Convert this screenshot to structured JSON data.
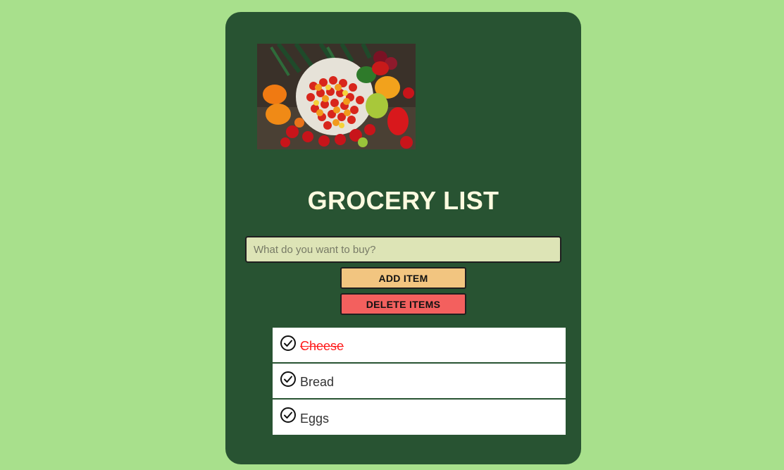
{
  "header": {
    "title": "GROCERY LIST",
    "hero_image": "vegetables-photo"
  },
  "form": {
    "search_placeholder": "What do you want to buy?",
    "search_value": "",
    "add_label": "ADD ITEM",
    "delete_label": "DELETE ITEMS"
  },
  "list": {
    "items": [
      {
        "label": "Cheese",
        "done": true,
        "icon": "check-circle-icon"
      },
      {
        "label": "Bread",
        "done": false,
        "icon": "check-circle-icon"
      },
      {
        "label": "Eggs",
        "done": false,
        "icon": "check-circle-icon"
      }
    ]
  },
  "colors": {
    "page_bg": "#a8e08c",
    "card_bg": "#285332",
    "title": "#fffbe0",
    "input_bg": "#dde4b6",
    "add_button": "#f2c580",
    "delete_button": "#f3605e",
    "done_text": "#ff1a1a"
  }
}
